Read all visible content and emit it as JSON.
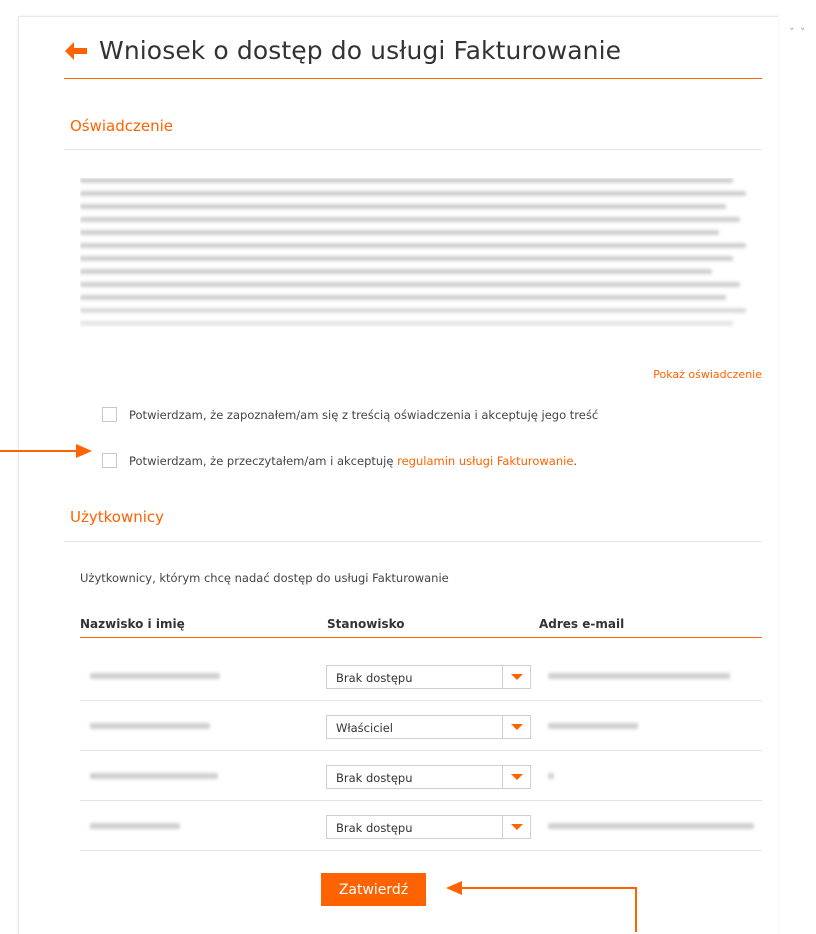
{
  "header": {
    "title": "Wniosek o dostęp do usługi Fakturowanie",
    "corner_mark": "˅ ˅"
  },
  "statement": {
    "section_title": "Oświadczenie",
    "show_link": "Pokaż oświadczenie"
  },
  "checkboxes": [
    {
      "label": "Potwierdzam, że zapoznałem/am się z treścią oświadczenia i akceptuję jego treść",
      "checked": false
    },
    {
      "label_prefix": "Potwierdzam, że przeczytałem/am i akceptuję ",
      "link_text": "regulamin usługi Fakturowanie",
      "label_suffix": ".",
      "checked": false
    }
  ],
  "users": {
    "section_title": "Użytkownicy",
    "description": "Użytkownicy, którym chcę nadać dostęp do usługi Fakturowanie",
    "columns": [
      "Nazwisko i imię",
      "Stanowisko",
      "Adres e-mail"
    ],
    "rows": [
      {
        "role": "Brak dostępu"
      },
      {
        "role": "Właściciel"
      },
      {
        "role": "Brak dostępu"
      },
      {
        "role": "Brak dostępu"
      }
    ],
    "submit_label": "Zatwierdź"
  },
  "colors": {
    "accent": "#ff6200",
    "text": "#333333",
    "divider": "#e5e5e5"
  }
}
